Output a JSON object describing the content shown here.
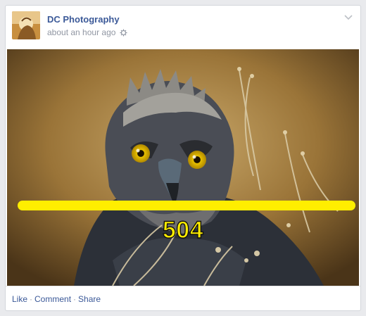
{
  "post": {
    "author_name": "DC Photography",
    "timestamp": "about an hour ago",
    "privacy_icon": "gear-icon",
    "options_icon": "chevron-down-icon"
  },
  "photo": {
    "subject": "eagle",
    "overlay": {
      "label": "504",
      "bar_color": "#ffee00"
    }
  },
  "actions": {
    "like_label": "Like",
    "comment_label": "Comment",
    "share_label": "Share",
    "separator": "·"
  },
  "colors": {
    "link": "#3b5998",
    "meta": "#9197a3",
    "overlay_accent": "#ffee00"
  }
}
